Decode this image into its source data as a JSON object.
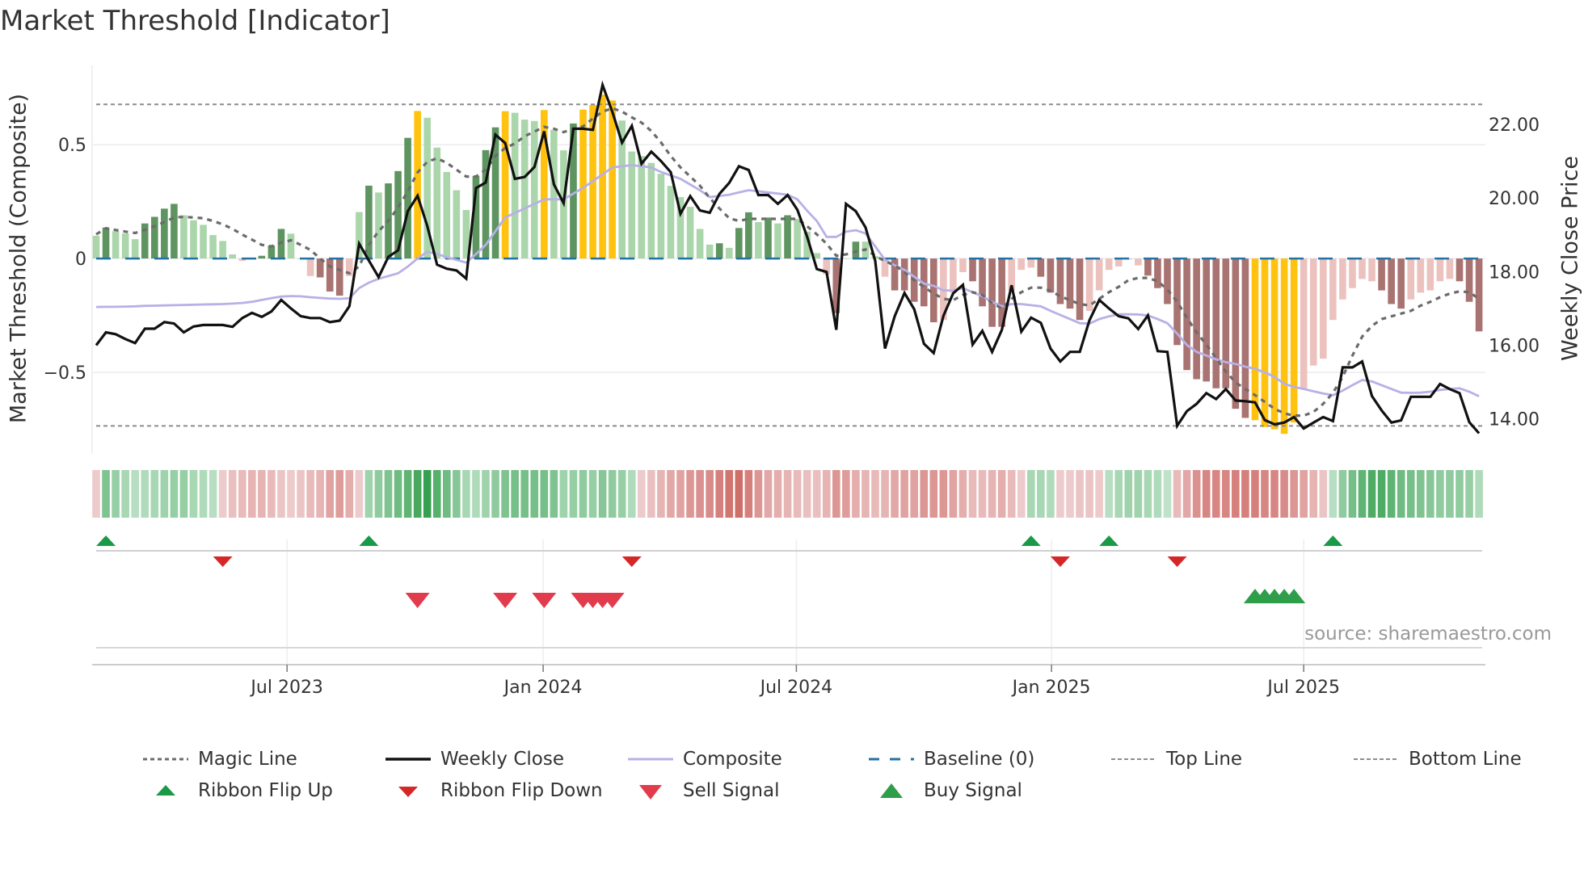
{
  "title": "Market Threshold [Indicator]",
  "source": "source: sharemaestro.com",
  "chart_data": {
    "type": "bar+line",
    "title": "Market Threshold [Indicator]",
    "frequency": "weekly",
    "left_axis": {
      "label": "Market Threshold (Composite)",
      "ylim": [
        -0.858,
        0.848
      ],
      "ticks": [
        0.5,
        0,
        -0.5
      ],
      "tick_labels": [
        "0.5",
        "0",
        "−0.5"
      ]
    },
    "right_axis": {
      "label": "Weekly Close Price",
      "ylim": [
        13.05,
        23.6
      ],
      "ticks": [
        22,
        20,
        18,
        16,
        14
      ],
      "tick_labels": [
        "22.00",
        "20.00",
        "18.00",
        "16.00",
        "14.00"
      ]
    },
    "x_ticks": [
      {
        "label": "Jul 2023",
        "week": 19.6
      },
      {
        "label": "Jan 2024",
        "week": 45.9
      },
      {
        "label": "Jul 2024",
        "week": 71.9
      },
      {
        "label": "Jan 2025",
        "week": 98.1
      },
      {
        "label": "Jul 2025",
        "week": 124.0
      }
    ],
    "top_line": 0.677,
    "bottom_line": -0.735,
    "baseline": 0,
    "bar_tone_key": {
      "G": "#5e9460",
      "g": "#abd6ab",
      "Y": "#ffc20e",
      "R": "#a87370",
      "r": "#ecc2bf"
    },
    "bar_tone_codes": "gGgggGGGGggggggrgGGGggrRRRrgGgGGGYgggggGGGYgggYggGYYYYggggggggggGgGGgGgGgggrRgGggrRRRRRrrrRRRRrrrRRRRRrrrrrrRRRRRRRRRRRYYYYYrrrrrrrrRRRrrrrrRRR",
    "composite_bars": [
      0.1,
      0.136,
      0.12,
      0.11,
      0.085,
      0.154,
      0.183,
      0.219,
      0.24,
      0.19,
      0.168,
      0.148,
      0.103,
      0.077,
      0.018,
      -0.01,
      0.0,
      0.012,
      0.057,
      0.13,
      0.109,
      0.0,
      -0.077,
      -0.083,
      -0.145,
      -0.163,
      -0.077,
      0.204,
      0.32,
      0.29,
      0.33,
      0.384,
      0.53,
      0.648,
      0.618,
      0.487,
      0.38,
      0.3,
      0.213,
      0.363,
      0.476,
      0.576,
      0.647,
      0.64,
      0.61,
      0.604,
      0.652,
      0.565,
      0.475,
      0.593,
      0.654,
      0.674,
      0.72,
      0.694,
      0.606,
      0.47,
      0.45,
      0.42,
      0.372,
      0.319,
      0.27,
      0.227,
      0.13,
      0.061,
      0.067,
      0.047,
      0.134,
      0.203,
      0.16,
      0.18,
      0.154,
      0.19,
      0.174,
      0.118,
      0.024,
      -0.07,
      -0.24,
      0.0,
      0.074,
      0.074,
      0.01,
      -0.08,
      -0.14,
      -0.14,
      -0.19,
      -0.21,
      -0.28,
      -0.27,
      -0.15,
      -0.06,
      -0.1,
      -0.21,
      -0.3,
      -0.3,
      -0.14,
      -0.05,
      -0.04,
      -0.08,
      -0.15,
      -0.2,
      -0.22,
      -0.27,
      -0.23,
      -0.14,
      -0.05,
      -0.035,
      -0.005,
      -0.03,
      -0.075,
      -0.13,
      -0.2,
      -0.38,
      -0.49,
      -0.53,
      -0.54,
      -0.57,
      -0.57,
      -0.66,
      -0.7,
      -0.71,
      -0.74,
      -0.75,
      -0.77,
      -0.72,
      -0.57,
      -0.47,
      -0.44,
      -0.27,
      -0.18,
      -0.13,
      -0.09,
      -0.1,
      -0.14,
      -0.2,
      -0.22,
      -0.18,
      -0.15,
      -0.14,
      -0.1,
      -0.09,
      -0.1,
      -0.19,
      -0.32
    ],
    "series": [
      {
        "name": "Magic Line",
        "axis": "left",
        "color": "#6b6b6b",
        "values": [
          0.106,
          0.133,
          0.125,
          0.118,
          0.112,
          0.125,
          0.142,
          0.16,
          0.18,
          0.183,
          0.18,
          0.177,
          0.165,
          0.15,
          0.13,
          0.105,
          0.083,
          0.06,
          0.053,
          0.07,
          0.08,
          0.06,
          0.038,
          0,
          -0.035,
          -0.05,
          -0.065,
          -0.035,
          0.06,
          0.12,
          0.165,
          0.224,
          0.295,
          0.378,
          0.425,
          0.44,
          0.42,
          0.39,
          0.36,
          0.36,
          0.39,
          0.45,
          0.485,
          0.505,
          0.537,
          0.557,
          0.578,
          0.57,
          0.555,
          0.57,
          0.58,
          0.615,
          0.645,
          0.66,
          0.645,
          0.62,
          0.597,
          0.56,
          0.51,
          0.45,
          0.4,
          0.36,
          0.32,
          0.266,
          0.22,
          0.177,
          0.165,
          0.174,
          0.174,
          0.174,
          0.174,
          0.174,
          0.174,
          0.142,
          0.106,
          0.065,
          0.012,
          0.018,
          0.03,
          0.04,
          0.012,
          -0.012,
          -0.03,
          -0.06,
          -0.095,
          -0.125,
          -0.154,
          -0.177,
          -0.183,
          -0.16,
          -0.148,
          -0.16,
          -0.195,
          -0.22,
          -0.177,
          -0.148,
          -0.128,
          -0.128,
          -0.142,
          -0.166,
          -0.183,
          -0.2,
          -0.206,
          -0.177,
          -0.148,
          -0.124,
          -0.095,
          -0.085,
          -0.085,
          -0.1,
          -0.136,
          -0.19,
          -0.26,
          -0.325,
          -0.378,
          -0.437,
          -0.497,
          -0.544,
          -0.573,
          -0.6,
          -0.63,
          -0.66,
          -0.68,
          -0.69,
          -0.69,
          -0.674,
          -0.638,
          -0.59,
          -0.52,
          -0.426,
          -0.343,
          -0.296,
          -0.266,
          -0.254,
          -0.242,
          -0.23,
          -0.207,
          -0.19,
          -0.17,
          -0.154,
          -0.144,
          -0.148,
          -0.177
        ]
      },
      {
        "name": "Weekly Close",
        "axis": "right",
        "color": "#111111",
        "values": [
          16.0,
          16.35,
          16.3,
          16.17,
          16.06,
          16.45,
          16.45,
          16.63,
          16.59,
          16.35,
          16.51,
          16.55,
          16.55,
          16.55,
          16.5,
          16.74,
          16.88,
          16.77,
          16.92,
          17.23,
          17.0,
          16.79,
          16.74,
          16.74,
          16.63,
          16.67,
          17.06,
          18.76,
          18.3,
          17.85,
          18.4,
          18.58,
          19.64,
          20.06,
          19.24,
          18.19,
          18.08,
          18.03,
          17.81,
          20.27,
          20.42,
          21.72,
          21.49,
          20.52,
          20.57,
          20.84,
          21.81,
          20.37,
          19.86,
          21.88,
          21.88,
          21.85,
          23.07,
          22.34,
          21.5,
          21.96,
          20.93,
          21.26,
          21.0,
          20.7,
          19.57,
          20.05,
          19.66,
          19.6,
          20.11,
          20.41,
          20.86,
          20.76,
          20.08,
          20.08,
          19.84,
          20.08,
          19.68,
          18.95,
          18.07,
          17.99,
          16.42,
          19.84,
          19.64,
          19.2,
          18.29,
          15.91,
          16.79,
          17.42,
          16.98,
          16.04,
          15.79,
          16.8,
          17.41,
          17.64,
          16.02,
          16.39,
          15.82,
          16.42,
          17.63,
          16.37,
          16.75,
          16.61,
          15.91,
          15.56,
          15.82,
          15.82,
          16.68,
          17.23,
          17.0,
          16.79,
          16.73,
          16.44,
          16.81,
          15.84,
          15.82,
          13.81,
          14.21,
          14.41,
          14.7,
          14.54,
          14.81,
          14.5,
          14.48,
          14.45,
          13.97,
          13.85,
          13.9,
          14.05,
          13.74,
          13.9,
          14.05,
          13.94,
          15.4,
          15.4,
          15.56,
          14.62,
          14.23,
          13.9,
          13.96,
          14.6,
          14.6,
          14.6,
          14.95,
          14.81,
          14.7,
          13.91,
          13.61
        ]
      },
      {
        "name": "Composite",
        "axis": "left",
        "color": "#b8b0e6",
        "values": [
          -0.213,
          -0.212,
          -0.212,
          -0.211,
          -0.21,
          -0.208,
          -0.207,
          -0.206,
          -0.205,
          -0.204,
          -0.203,
          -0.202,
          -0.201,
          -0.2,
          -0.198,
          -0.195,
          -0.19,
          -0.182,
          -0.174,
          -0.167,
          -0.165,
          -0.166,
          -0.17,
          -0.173,
          -0.176,
          -0.177,
          -0.175,
          -0.13,
          -0.106,
          -0.089,
          -0.077,
          -0.065,
          -0.035,
          0,
          0.03,
          0.02,
          0.006,
          -0.006,
          -0.018,
          0.02,
          0.06,
          0.12,
          0.18,
          0.2,
          0.22,
          0.24,
          0.26,
          0.26,
          0.26,
          0.285,
          0.31,
          0.34,
          0.37,
          0.4,
          0.405,
          0.41,
          0.405,
          0.4,
          0.38,
          0.365,
          0.35,
          0.325,
          0.3,
          0.27,
          0.275,
          0.28,
          0.29,
          0.3,
          0.295,
          0.29,
          0.285,
          0.28,
          0.26,
          0.21,
          0.165,
          0.095,
          0.095,
          0.118,
          0.124,
          0.11,
          0.053,
          -0.006,
          -0.03,
          -0.05,
          -0.08,
          -0.11,
          -0.12,
          -0.14,
          -0.14,
          -0.13,
          -0.148,
          -0.166,
          -0.19,
          -0.21,
          -0.2,
          -0.2,
          -0.205,
          -0.21,
          -0.23,
          -0.248,
          -0.266,
          -0.284,
          -0.286,
          -0.266,
          -0.254,
          -0.245,
          -0.245,
          -0.246,
          -0.25,
          -0.266,
          -0.284,
          -0.33,
          -0.38,
          -0.41,
          -0.426,
          -0.443,
          -0.455,
          -0.463,
          -0.475,
          -0.484,
          -0.5,
          -0.52,
          -0.55,
          -0.564,
          -0.573,
          -0.583,
          -0.593,
          -0.6,
          -0.58,
          -0.556,
          -0.534,
          -0.54,
          -0.556,
          -0.573,
          -0.589,
          -0.59,
          -0.589,
          -0.585,
          -0.577,
          -0.573,
          -0.57,
          -0.585,
          -0.605
        ]
      }
    ],
    "ribbon": [
      -0.15,
      0.55,
      0.4,
      0.3,
      0.2,
      0.25,
      0.3,
      0.35,
      0.4,
      0.4,
      0.3,
      0.25,
      0.2,
      -0.15,
      -0.25,
      -0.3,
      -0.35,
      -0.35,
      -0.3,
      -0.2,
      -0.15,
      -0.2,
      -0.3,
      -0.35,
      -0.5,
      -0.55,
      -0.4,
      -0.15,
      0.35,
      0.45,
      0.55,
      0.65,
      0.75,
      0.9,
      1.0,
      0.8,
      0.65,
      0.5,
      0.3,
      0.25,
      0.35,
      0.45,
      0.55,
      0.6,
      0.6,
      0.6,
      0.6,
      0.55,
      0.35,
      0.4,
      0.45,
      0.4,
      0.5,
      0.45,
      0.4,
      0.25,
      -0.15,
      -0.25,
      -0.35,
      -0.45,
      -0.5,
      -0.6,
      -0.65,
      -0.7,
      -0.8,
      -0.9,
      -0.95,
      -0.8,
      -0.6,
      -0.45,
      -0.4,
      -0.35,
      -0.3,
      -0.25,
      -0.25,
      -0.35,
      -0.6,
      -0.55,
      -0.4,
      -0.35,
      -0.3,
      -0.35,
      -0.45,
      -0.5,
      -0.5,
      -0.6,
      -0.6,
      -0.6,
      -0.5,
      -0.4,
      -0.3,
      -0.3,
      -0.35,
      -0.4,
      -0.3,
      -0.15,
      0.3,
      0.3,
      0.25,
      -0.15,
      -0.15,
      -0.2,
      -0.2,
      -0.15,
      0.2,
      0.3,
      0.35,
      0.35,
      0.3,
      0.25,
      0.15,
      -0.3,
      -0.45,
      -0.65,
      -0.75,
      -0.75,
      -0.75,
      -0.8,
      -0.8,
      -0.8,
      -0.75,
      -0.75,
      -0.7,
      -0.6,
      -0.5,
      -0.35,
      -0.2,
      0.2,
      0.45,
      0.6,
      0.75,
      0.85,
      0.85,
      0.75,
      0.65,
      0.6,
      0.55,
      0.5,
      0.45,
      0.45,
      0.45,
      0.4,
      0.25
    ],
    "events": {
      "ribbon_flip_up": [
        1,
        28,
        96,
        104,
        127
      ],
      "ribbon_flip_down": [
        13,
        55,
        99,
        111
      ],
      "sell_signal": [
        33,
        42,
        46,
        50,
        51,
        52,
        53
      ],
      "buy_signal": [
        119,
        120,
        121,
        122,
        123
      ]
    },
    "colors": {
      "baseline": "#2471a3",
      "threshold": "#8c8c8c",
      "flip_up": "#1a9a48",
      "flip_down": "#d62728",
      "sell": "#e23b4b",
      "buy": "#2e9e4a"
    },
    "legend": {
      "placement": "bottom",
      "items": [
        {
          "key": "magic",
          "label": "Magic Line"
        },
        {
          "key": "close",
          "label": "Weekly Close"
        },
        {
          "key": "composite",
          "label": "Composite"
        },
        {
          "key": "baseline",
          "label": "Baseline (0)"
        },
        {
          "key": "top",
          "label": "Top Line"
        },
        {
          "key": "bottom",
          "label": "Bottom Line"
        },
        {
          "key": "flip_up",
          "label": "Ribbon Flip Up"
        },
        {
          "key": "flip_down",
          "label": "Ribbon Flip Down"
        },
        {
          "key": "sell",
          "label": "Sell Signal"
        },
        {
          "key": "buy",
          "label": "Buy Signal"
        }
      ]
    }
  }
}
